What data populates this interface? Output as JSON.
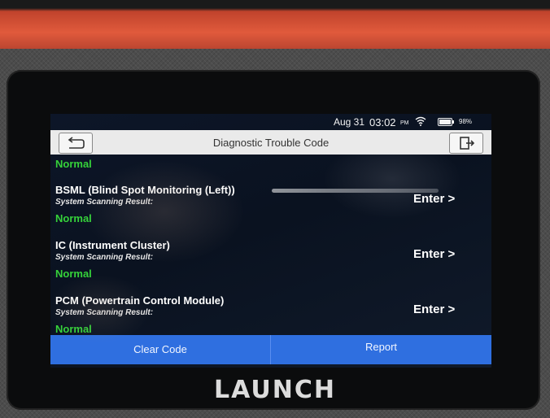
{
  "status": {
    "date": "Aug 31",
    "time": "03:02",
    "ampm": "PM",
    "battery": "98%",
    "battery_level": 0.98
  },
  "header": {
    "title": "Diagnostic Trouble Code",
    "back_icon": "back-arrow-icon",
    "exit_icon": "exit-icon"
  },
  "list": {
    "top_result": "Normal",
    "items": [
      {
        "name": "BSML (Blind Spot Monitoring (Left))",
        "sub": "System Scanning Result:",
        "result": "Normal",
        "enter": "Enter >"
      },
      {
        "name": "IC (Instrument Cluster)",
        "sub": "System Scanning Result:",
        "result": "Normal",
        "enter": "Enter >"
      },
      {
        "name": "PCM (Powertrain Control Module)",
        "sub": "System Scanning Result:",
        "result": "Normal",
        "enter": "Enter >"
      }
    ]
  },
  "footer": {
    "clear_label": "Clear Code",
    "report_label": "Report"
  },
  "device": {
    "brand": "LAUNCH"
  },
  "colors": {
    "accent": "#2f6fe0",
    "normal": "#35d23a",
    "titlebar": "#eaeaea"
  }
}
